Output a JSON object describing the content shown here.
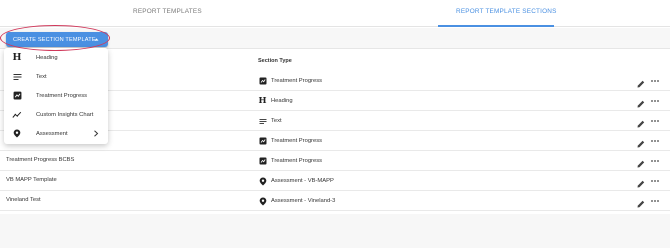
{
  "tabs": [
    {
      "label": "REPORT TEMPLATES",
      "active": false
    },
    {
      "label": "REPORT TEMPLATE SECTIONS",
      "active": true
    }
  ],
  "colors": {
    "accent": "#4a90e2",
    "highlight_ring": "#d0395b"
  },
  "toolbar": {
    "create_label": "CREATE SECTION TEMPLATE"
  },
  "table": {
    "column_type_header": "Section Type",
    "rows": [
      {
        "name": "",
        "type": "Treatment Progress",
        "icon": "treatment-progress-icon"
      },
      {
        "name": "",
        "type": "Heading",
        "icon": "heading-icon"
      },
      {
        "name": "",
        "type": "Text",
        "icon": "text-icon"
      },
      {
        "name": "",
        "type": "Treatment Progress",
        "icon": "treatment-progress-icon"
      },
      {
        "name": "Treatment Progress BCBS",
        "type": "Treatment Progress",
        "icon": "treatment-progress-icon"
      },
      {
        "name": "VB MAPP Template",
        "type": "Assessment - VB-MAPP",
        "icon": "assessment-icon"
      },
      {
        "name": "Vineland Test",
        "type": "Assessment - Vineland-3",
        "icon": "assessment-icon"
      }
    ]
  },
  "menu": {
    "items": [
      {
        "label": "Heading",
        "icon": "heading-icon"
      },
      {
        "label": "Text",
        "icon": "text-icon"
      },
      {
        "label": "Treatment Progress",
        "icon": "treatment-progress-icon"
      },
      {
        "label": "Custom Insights Chart",
        "icon": "insights-chart-icon"
      },
      {
        "label": "Assessment",
        "icon": "assessment-icon",
        "submenu": true
      }
    ]
  }
}
